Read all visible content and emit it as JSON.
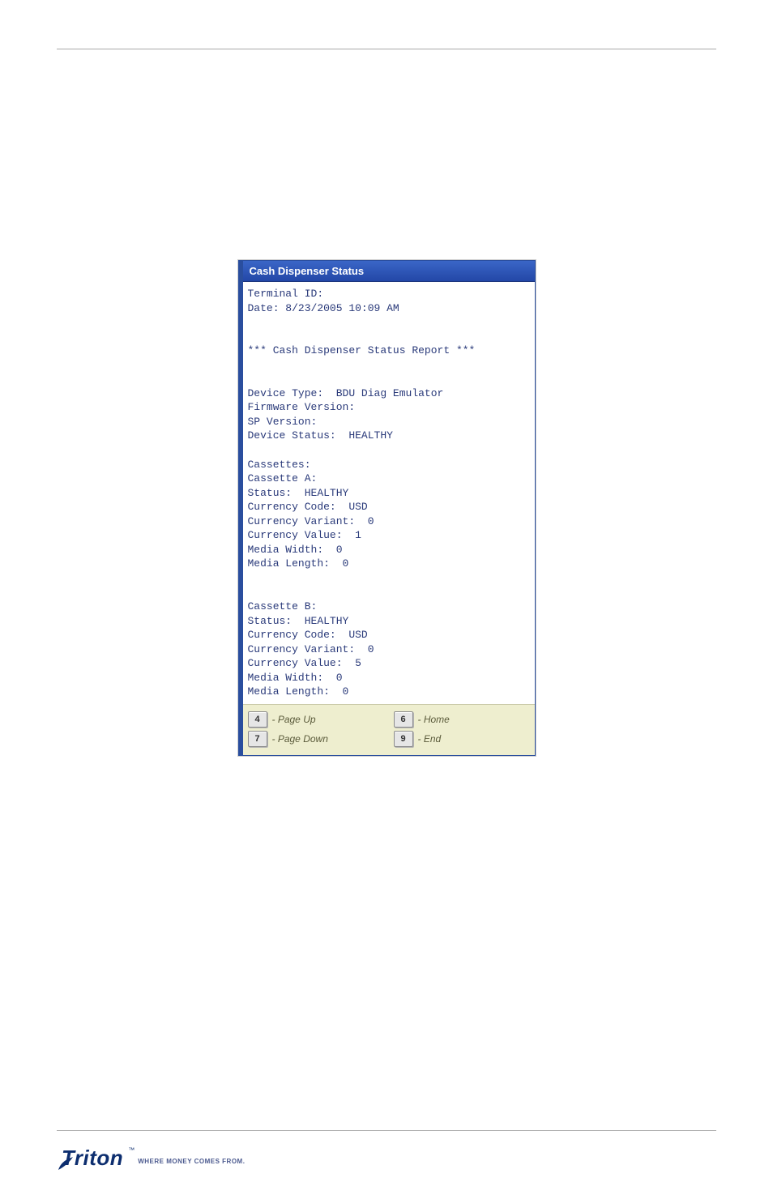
{
  "window": {
    "title": "Cash Dispenser Status"
  },
  "report": {
    "terminal_id_line": "Terminal ID:",
    "date_line": "Date: 8/23/2005 10:09 AM",
    "header": "*** Cash Dispenser Status Report ***",
    "device_type": "Device Type:  BDU Diag Emulator",
    "firmware_version": "Firmware Version:",
    "sp_version": "SP Version:",
    "device_status": "Device Status:  HEALTHY",
    "cassettes_header": "Cassettes:",
    "cassette_a": {
      "title": "Cassette A:",
      "status": "Status:  HEALTHY",
      "currency_code": "Currency Code:  USD",
      "currency_variant": "Currency Variant:  0",
      "currency_value": "Currency Value:  1",
      "media_width": "Media Width:  0",
      "media_length": "Media Length:  0"
    },
    "cassette_b": {
      "title": "Cassette B:",
      "status": "Status:  HEALTHY",
      "currency_code": "Currency Code:  USD",
      "currency_variant": "Currency Variant:  0",
      "currency_value": "Currency Value:  5",
      "media_width": "Media Width:  0",
      "media_length": "Media Length:  0"
    }
  },
  "nav": {
    "page_up": {
      "key": "4",
      "label": "- Page Up"
    },
    "home": {
      "key": "6",
      "label": "- Home"
    },
    "page_dn": {
      "key": "7",
      "label": "- Page Down"
    },
    "end": {
      "key": "9",
      "label": "- End"
    }
  },
  "footer": {
    "brand": "Triton",
    "tagline": "WHERE MONEY COMES FROM.",
    "tm": "™"
  }
}
